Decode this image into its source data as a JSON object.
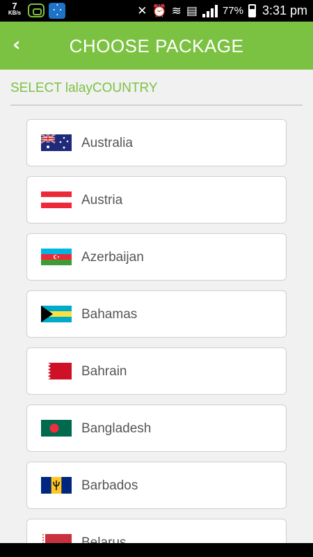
{
  "status_bar": {
    "speed_value": "7",
    "speed_unit": "KB/s",
    "battery": "77%",
    "time": "3:31 pm"
  },
  "header": {
    "back_icon": "‹",
    "title": "CHOOSE PACKAGE"
  },
  "section": {
    "title": "SELECT lalayCOUNTRY"
  },
  "countries": [
    {
      "name": "Australia",
      "flag_icon": "australia-flag"
    },
    {
      "name": "Austria",
      "flag_icon": "austria-flag"
    },
    {
      "name": "Azerbaijan",
      "flag_icon": "azerbaijan-flag"
    },
    {
      "name": "Bahamas",
      "flag_icon": "bahamas-flag"
    },
    {
      "name": "Bahrain",
      "flag_icon": "bahrain-flag"
    },
    {
      "name": "Bangladesh",
      "flag_icon": "bangladesh-flag"
    },
    {
      "name": "Barbados",
      "flag_icon": "barbados-flag"
    },
    {
      "name": "Belarus",
      "flag_icon": "belarus-flag"
    }
  ],
  "colors": {
    "accent": "#7cc242",
    "background": "#f1f1f1"
  }
}
